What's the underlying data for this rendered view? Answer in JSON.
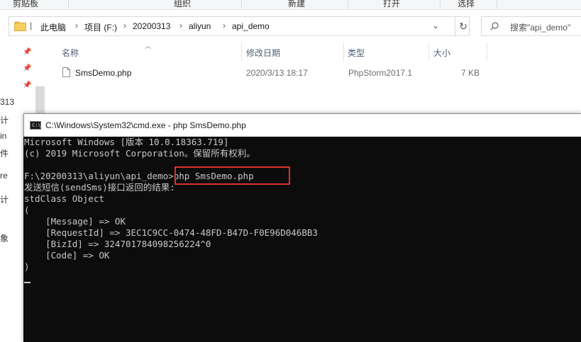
{
  "ribbon": {
    "groups": [
      "剪贴板",
      "组织",
      "新建",
      "打开",
      "选择"
    ]
  },
  "address": {
    "crumbs": [
      "此电脑",
      "项目 (F:)",
      "20200313",
      "aliyun",
      "api_demo"
    ],
    "dropdown_icon": "chevron-down-icon",
    "refresh_icon": "refresh-icon"
  },
  "search": {
    "placeholder": "搜索\"api_demo\""
  },
  "left_pane": {
    "fragments": [
      "313",
      "计",
      "in",
      "件",
      "re",
      "计",
      "象"
    ]
  },
  "columns": {
    "name": "名称",
    "date": "修改日期",
    "type": "类型",
    "size": "大小"
  },
  "files": [
    {
      "name": "SmsDemo.php",
      "date": "2020/3/13 18:17",
      "type": "PhpStorm2017.1",
      "size": "7 KB"
    }
  ],
  "cmd": {
    "title": "C:\\Windows\\System32\\cmd.exe - php  SmsDemo.php",
    "icon_text": "C:\\",
    "lines": [
      "Microsoft Windows [版本 10.0.18363.719]",
      "(c) 2019 Microsoft Corporation。保留所有权利。",
      "",
      "F:\\20200313\\aliyun\\api_demo>php SmsDemo.php",
      "发送短信(sendSms)接口返回的结果:",
      "stdClass Object",
      "(",
      "    [Message] => OK",
      "    [RequestId] => 3EC1C9CC-0474-48FD-B47D-F0E96D046BB3",
      "    [BizId] => 324701784098256224^0",
      "    [Code] => OK",
      ")"
    ]
  },
  "colors": {
    "console_bg": "#0c0c0c",
    "console_text": "#c8c8c8",
    "highlight": "#e0302a",
    "column_header": "#4c607a"
  }
}
